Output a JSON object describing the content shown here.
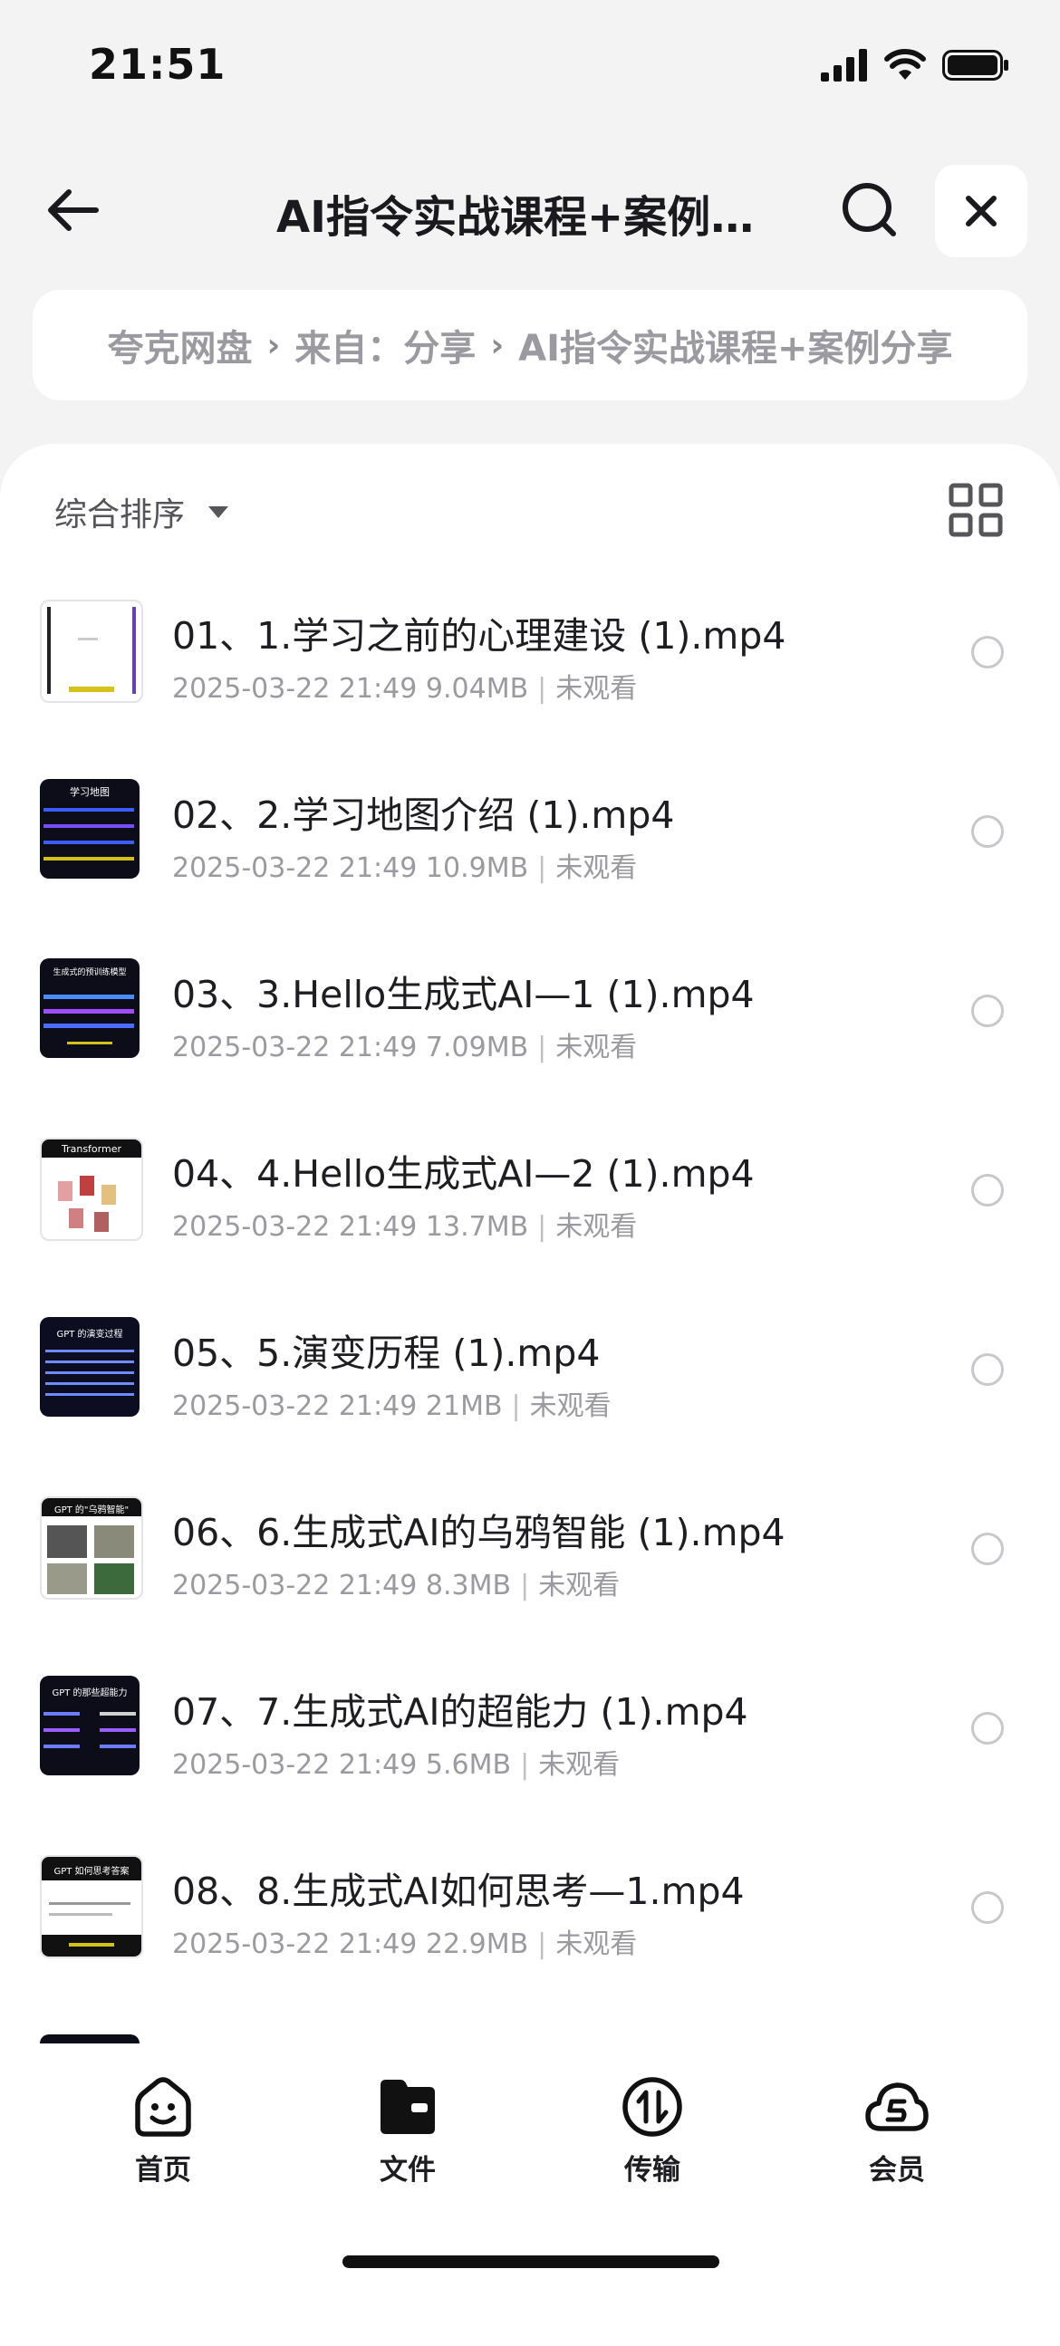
{
  "status_bar": {
    "time": "21:51"
  },
  "header": {
    "title": "AI指令实战课程+案例分享"
  },
  "breadcrumb": {
    "root": "夸克网盘",
    "source": "来自：分享",
    "folder": "AI指令实战课程+案例分享"
  },
  "toolbar": {
    "sort_label": "综合排序"
  },
  "files": [
    {
      "name": "01、1.学习之前的心理建设 (1).mp4",
      "date": "2025-03-22 21:49",
      "size": "9.04MB",
      "status": "未观看"
    },
    {
      "name": "02、2.学习地图介绍 (1).mp4",
      "date": "2025-03-22 21:49",
      "size": "10.9MB",
      "status": "未观看"
    },
    {
      "name": "03、3.Hello生成式AI—1 (1).mp4",
      "date": "2025-03-22 21:49",
      "size": "7.09MB",
      "status": "未观看"
    },
    {
      "name": "04、4.Hello生成式AI—2 (1).mp4",
      "date": "2025-03-22 21:49",
      "size": "13.7MB",
      "status": "未观看"
    },
    {
      "name": "05、5.演变历程 (1).mp4",
      "date": "2025-03-22 21:49",
      "size": "21MB",
      "status": "未观看"
    },
    {
      "name": "06、6.生成式AI的乌鸦智能 (1).mp4",
      "date": "2025-03-22 21:49",
      "size": "8.3MB",
      "status": "未观看"
    },
    {
      "name": "07、7.生成式AI的超能力 (1).mp4",
      "date": "2025-03-22 21:49",
      "size": "5.6MB",
      "status": "未观看"
    },
    {
      "name": "08、8.生成式AI如何思考—1.mp4",
      "date": "2025-03-22 21:49",
      "size": "22.9MB",
      "status": "未观看"
    }
  ],
  "thumbnails": [
    {
      "caption": ""
    },
    {
      "caption": "学习地图"
    },
    {
      "caption": "生成式的预训练模型"
    },
    {
      "caption": "Transformer"
    },
    {
      "caption": "GPT 的演变过程"
    },
    {
      "caption": "GPT 的\"乌鸦智能\""
    },
    {
      "caption": "GPT 的那些超能力"
    },
    {
      "caption": "GPT 如何思考答案"
    }
  ],
  "bottom_nav": {
    "home": "首页",
    "files": "文件",
    "transfer": "传输",
    "member": "会员"
  },
  "colors": {
    "accent": "#1e1e22",
    "muted": "#9a9aa0",
    "page_bg": "#f3f3f4",
    "card_bg": "#ffffff"
  }
}
